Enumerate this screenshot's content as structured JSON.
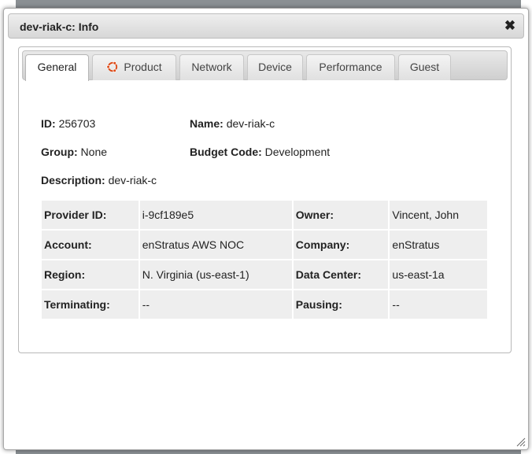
{
  "dialog": {
    "title": "dev-riak-c: Info",
    "close_glyph": "✖"
  },
  "tabs": [
    {
      "label": "General",
      "active": true
    },
    {
      "label": "Product",
      "icon": "ubuntu-icon"
    },
    {
      "label": "Network"
    },
    {
      "label": "Device"
    },
    {
      "label": "Performance"
    },
    {
      "label": "Guest"
    }
  ],
  "general": {
    "id_label": "ID:",
    "id_value": "256703",
    "name_label": "Name:",
    "name_value": "dev-riak-c",
    "group_label": "Group:",
    "group_value": "None",
    "budget_label": "Budget Code:",
    "budget_value": "Development",
    "description_label": "Description:",
    "description_value": "dev-riak-c"
  },
  "details": [
    {
      "k1": "Provider ID:",
      "v1": "i-9cf189e5",
      "k2": "Owner:",
      "v2": "Vincent, John"
    },
    {
      "k1": "Account:",
      "v1": "enStratus AWS NOC",
      "k2": "Company:",
      "v2": "enStratus"
    },
    {
      "k1": "Region:",
      "v1": "N. Virginia (us-east-1)",
      "k2": "Data Center:",
      "v2": "us-east-1a"
    },
    {
      "k1": "Terminating:",
      "v1": "--",
      "k2": "Pausing:",
      "v2": "--"
    }
  ],
  "colors": {
    "ubuntu_orange": "#dd4814",
    "overlay_gray": "#8a8f93"
  }
}
